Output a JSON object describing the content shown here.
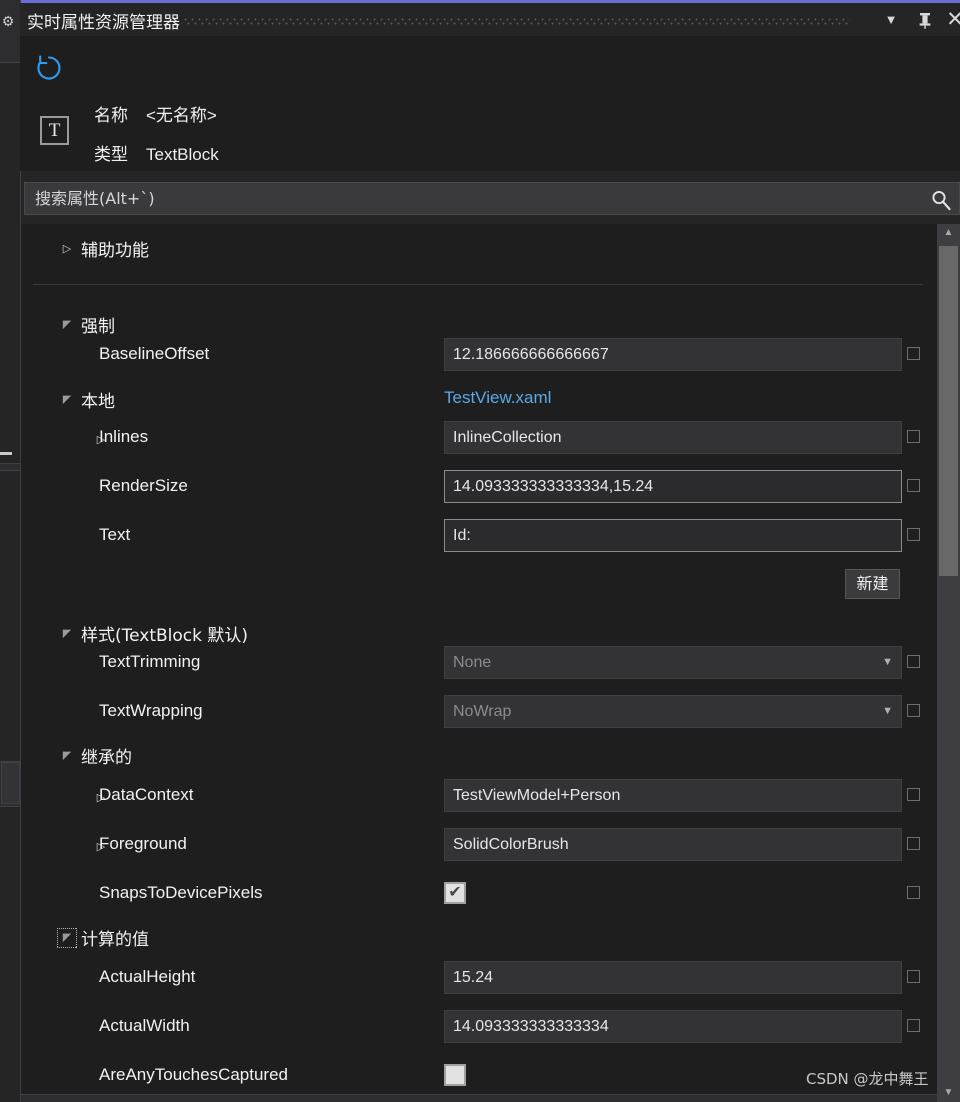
{
  "colors": {
    "accent": "#6a6fd4",
    "window_bg": "#1e1e1e",
    "chrome_bg": "#252526",
    "field_bg": "#333335",
    "link": "#5aa9e6",
    "text": "#f2f2f2"
  },
  "titlebar": {
    "title": "实时属性资源管理器",
    "caret_icon": "chevron-down-icon",
    "pin_icon": "pin-icon",
    "close_icon": "close-icon"
  },
  "header": {
    "refresh_icon": "refresh-icon",
    "type_badge": "T",
    "name_key": "名称",
    "name_value": "<无名称>",
    "type_key": "类型",
    "type_value": "TextBlock"
  },
  "search": {
    "placeholder": "搜索属性(Alt+`)",
    "value": "",
    "icon": "search-icon"
  },
  "buttons": {
    "new_label": "新建"
  },
  "properties": [
    {
      "label": "辅助功能",
      "kind": "group",
      "indent": 0,
      "expanded": false
    },
    {
      "label": "强制",
      "kind": "group",
      "indent": 0,
      "expanded": true
    },
    {
      "label": "BaselineOffset",
      "kind": "text",
      "indent": 1,
      "value": "12.186666666666667",
      "state": "normal"
    },
    {
      "label": "本地",
      "kind": "group",
      "indent": 0,
      "expanded": true,
      "link": "TestView.xaml"
    },
    {
      "label": "Inlines",
      "kind": "text",
      "indent": 1,
      "expandable": true,
      "value": "InlineCollection",
      "state": "normal"
    },
    {
      "label": "RenderSize",
      "kind": "text",
      "indent": 1,
      "value": "14.093333333333334,15.24",
      "state": "active"
    },
    {
      "label": "Text",
      "kind": "text",
      "indent": 1,
      "value": "Id:",
      "state": "active"
    },
    {
      "label": "样式(TextBlock 默认)",
      "kind": "group",
      "indent": 0,
      "expanded": true
    },
    {
      "label": "TextTrimming",
      "kind": "combo",
      "indent": 1,
      "value": "None"
    },
    {
      "label": "TextWrapping",
      "kind": "combo",
      "indent": 1,
      "value": "NoWrap"
    },
    {
      "label": "继承的",
      "kind": "group",
      "indent": 0,
      "expanded": true
    },
    {
      "label": "DataContext",
      "kind": "text",
      "indent": 1,
      "expandable": true,
      "value": "TestViewModel+Person",
      "state": "normal"
    },
    {
      "label": "Foreground",
      "kind": "text",
      "indent": 1,
      "expandable": true,
      "value": "SolidColorBrush",
      "state": "normal"
    },
    {
      "label": "SnapsToDevicePixels",
      "kind": "check",
      "indent": 1,
      "checked": true
    },
    {
      "label": "计算的值",
      "kind": "group",
      "indent": 0,
      "expanded": true,
      "focused": true
    },
    {
      "label": "ActualHeight",
      "kind": "text",
      "indent": 1,
      "value": "15.24",
      "state": "normal"
    },
    {
      "label": "ActualWidth",
      "kind": "text",
      "indent": 1,
      "value": "14.093333333333334",
      "state": "normal"
    },
    {
      "label": "AreAnyTouchesCaptured",
      "kind": "check",
      "indent": 1,
      "checked": false
    }
  ],
  "scrollbar": {
    "up_icon": "scroll-up-arrow-icon",
    "down_icon": "scroll-down-arrow-icon"
  },
  "watermark": "CSDN @龙中舞王"
}
